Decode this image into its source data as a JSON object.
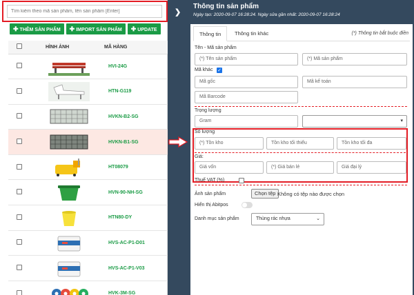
{
  "search": {
    "placeholder": "Tìm kiếm theo mã sản phẩm, tên sản phẩm [Enter]"
  },
  "toolbar": {
    "add_label": "THÊM SẢN PHẨM",
    "import_label": "IMPORT SẢN PHẨM",
    "update_label": "UPDATE"
  },
  "table": {
    "headers": {
      "image": "HÌNH ẢNH",
      "code": "MÃ HÀNG"
    },
    "rows": [
      {
        "code": "HVI-24G",
        "thumb": "bench"
      },
      {
        "code": "HTN-G119",
        "thumb": "lounger"
      },
      {
        "code": "HVKN-B2-SG",
        "thumb": "grill-tray"
      },
      {
        "code": "HVKN-B1-SG",
        "thumb": "grill-tray-dark"
      },
      {
        "code": "HT08079",
        "thumb": "mop-bucket"
      },
      {
        "code": "HVN-90-NH-SG",
        "thumb": "green-bin"
      },
      {
        "code": "HTN80-DY",
        "thumb": "yellow-bucket"
      },
      {
        "code": "HVS-AC-P1-D01",
        "thumb": "paint-can"
      },
      {
        "code": "HVS-AC-P1-V03",
        "thumb": "paint-can"
      },
      {
        "code": "HVK-3M-SG",
        "thumb": "tape-rolls"
      }
    ]
  },
  "panel": {
    "title": "Thông tin sản phẩm",
    "created_label": "Ngày tạo:",
    "created_value": "2020-09-07 16:28:24.",
    "updated_label": "Ngày sửa gần nhất:",
    "updated_value": "2020-09-07 16:28:24",
    "tabs": [
      "Thông tin",
      "Thông tin khác"
    ],
    "required_note": "(*) Thông tin bắt buộc điền"
  },
  "form": {
    "name_code_label": "Tên - Mã sản phẩm",
    "name_placeholder": "(*) Tên sản phẩm",
    "code_placeholder": "(*) Mã sản phẩm",
    "other_code_label": "Mã khác",
    "original_code_placeholder": "Mã gốc",
    "accounting_code_placeholder": "Mã kế toán",
    "barcode_placeholder": "Mã Barcode",
    "weight_label": "Trọng lượng",
    "weight_placeholder": "Gram",
    "quantity_label": "Số lượng",
    "stock_placeholder": "(*) Tồn kho",
    "min_stock_placeholder": "Tồn kho tối thiểu",
    "max_stock_placeholder": "Tồn kho tối đa",
    "price_label": "Giá:",
    "cost_placeholder": "Giá vốn",
    "retail_placeholder": "(*) Giá bán lẻ",
    "agent_placeholder": "Giá đại lý",
    "vat_label": "Thuế VAT (%)",
    "image_label": "Ảnh sản phẩm",
    "choose_file_label": "Chọn tệp",
    "no_file_text": "Không có tệp nào được chọn",
    "show_abitpos_label": "Hiển thị Abitpos",
    "category_label": "Danh mục sản phẩm",
    "category_value": "Thùng rác nhựa"
  },
  "colors": {
    "accent_green": "#1a9b45",
    "panel_dark": "#34495e",
    "highlight_red": "#e31b23",
    "row_highlight": "#fde8e3"
  },
  "icons": [
    "plus-icon",
    "chevron-right-icon",
    "arrow-right-icon",
    "checkbox-icon",
    "chevron-down-icon"
  ]
}
